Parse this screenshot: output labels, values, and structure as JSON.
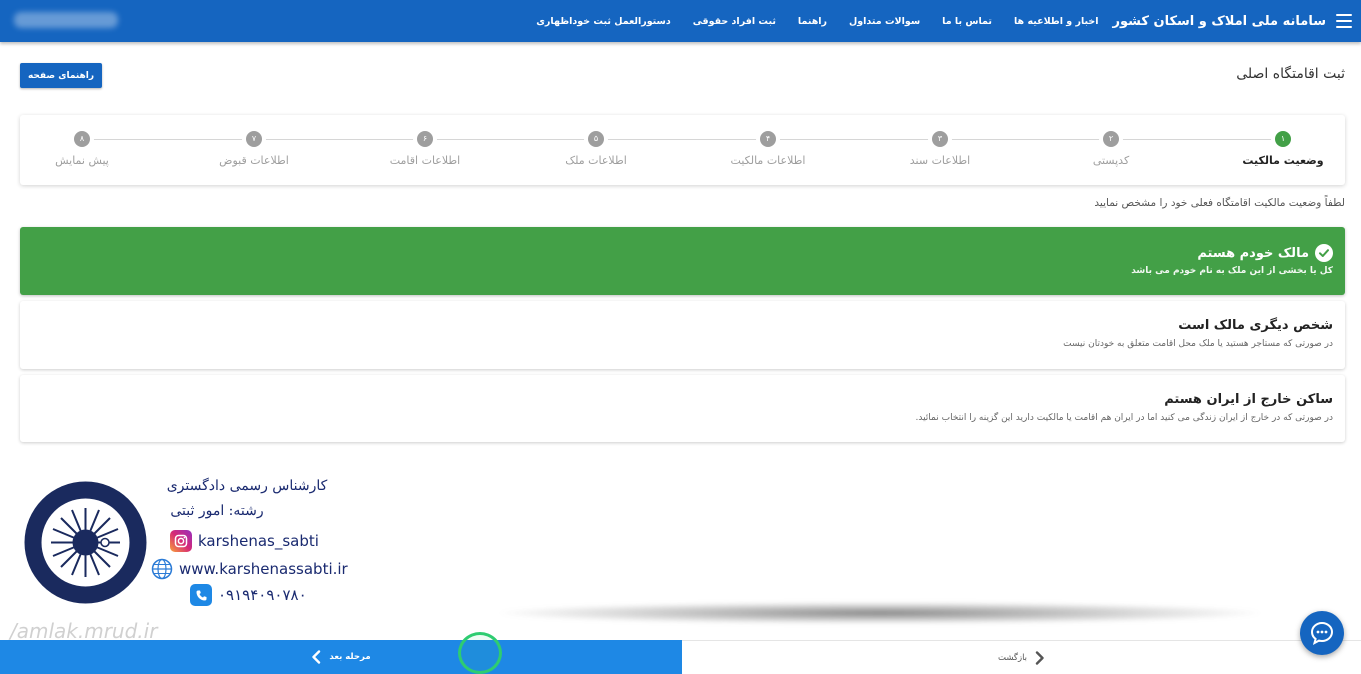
{
  "navbar": {
    "brand": "سامانه ملی املاک و اسکان کشور",
    "links": [
      "اخبار و اطلاعیه ها",
      "تماس با ما",
      "سوالات متداول",
      "راهنما",
      "ثبت افراد حقوقی",
      "دستورالعمل ثبت خوداظهاری"
    ]
  },
  "page": {
    "title": "ثبت اقامتگاه اصلی",
    "help_button": "راهنمای صفحه",
    "instruction": "لطفاً وضعیت مالکیت اقامتگاه فعلی خود را مشخص نمایید"
  },
  "stepper": {
    "steps": [
      {
        "num": "۱",
        "label": "وضعیت مالکیت"
      },
      {
        "num": "۲",
        "label": "کدپستی"
      },
      {
        "num": "۳",
        "label": "اطلاعات سند"
      },
      {
        "num": "۴",
        "label": "اطلاعات مالکیت"
      },
      {
        "num": "۵",
        "label": "اطلاعات ملک"
      },
      {
        "num": "۶",
        "label": "اطلاعات اقامت"
      },
      {
        "num": "۷",
        "label": "اطلاعات قبوض"
      },
      {
        "num": "۸",
        "label": "پیش نمایش"
      }
    ]
  },
  "options": [
    {
      "title": "مالک خودم هستم",
      "subtitle": "کل یا بخشی از این ملک به نام خودم می باشد"
    },
    {
      "title": "شخص دیگری مالک است",
      "subtitle": "در صورتی که مستاجر هستید یا ملک محل اقامت متعلق به خودتان نیست"
    },
    {
      "title": "ساکن خارج از ایران هستم",
      "subtitle": "در صورتی که در خارج از ایران زندگی می کنید اما در ایران هم اقامت یا مالکیت دارید این گزینه را انتخاب نمائید."
    }
  ],
  "watermark": {
    "line1": "کارشناس رسمی دادگستری",
    "line2": "رشته: امور ثبتی",
    "instagram": "karshenas_sabti",
    "website": "www.karshenassabti.ir",
    "phone": "۰۹۱۹۴۰۹۰۷۸۰",
    "site_mark": "/amlak.mrud.ir"
  },
  "bottom": {
    "next": "مرحله بعد",
    "back": "بازگشت"
  },
  "colors": {
    "primary": "#1565c0",
    "success": "#43a047",
    "next_button": "#1e88e5"
  }
}
